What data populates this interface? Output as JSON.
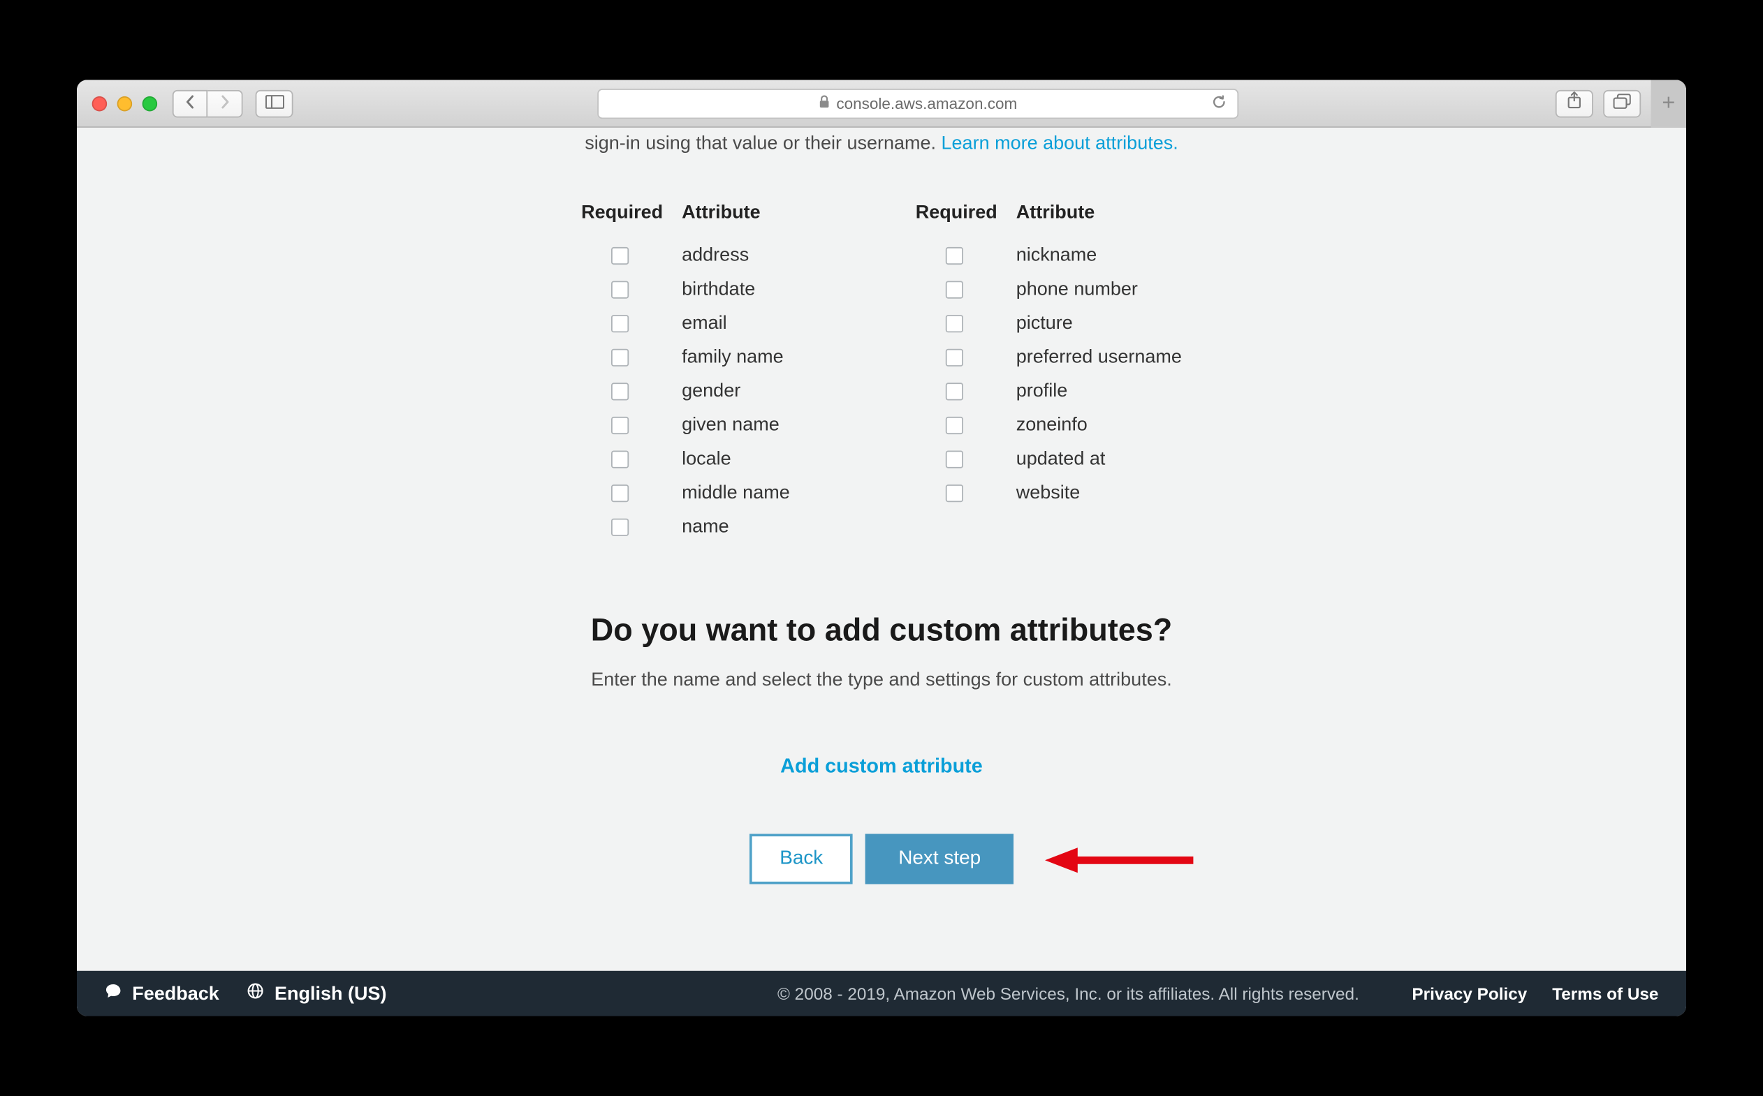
{
  "browser": {
    "url_host": "console.aws.amazon.com"
  },
  "top_fragment": {
    "text_prefix": "sign-in using that value or their username. ",
    "link": "Learn more about attributes."
  },
  "attr_headers": {
    "required": "Required",
    "attribute": "Attribute"
  },
  "attributes_col1": [
    {
      "label": "address"
    },
    {
      "label": "birthdate"
    },
    {
      "label": "email"
    },
    {
      "label": "family name"
    },
    {
      "label": "gender"
    },
    {
      "label": "given name"
    },
    {
      "label": "locale"
    },
    {
      "label": "middle name"
    },
    {
      "label": "name"
    }
  ],
  "attributes_col2": [
    {
      "label": "nickname"
    },
    {
      "label": "phone number"
    },
    {
      "label": "picture"
    },
    {
      "label": "preferred username"
    },
    {
      "label": "profile"
    },
    {
      "label": "zoneinfo"
    },
    {
      "label": "updated at"
    },
    {
      "label": "website"
    }
  ],
  "custom_section": {
    "heading": "Do you want to add custom attributes?",
    "sub": "Enter the name and select the type and settings for custom attributes.",
    "add_link": "Add custom attribute"
  },
  "buttons": {
    "back": "Back",
    "next": "Next step"
  },
  "footer": {
    "feedback": "Feedback",
    "language": "English (US)",
    "copyright": "© 2008 - 2019, Amazon Web Services, Inc. or its affiliates. All rights reserved.",
    "privacy": "Privacy Policy",
    "terms": "Terms of Use"
  }
}
